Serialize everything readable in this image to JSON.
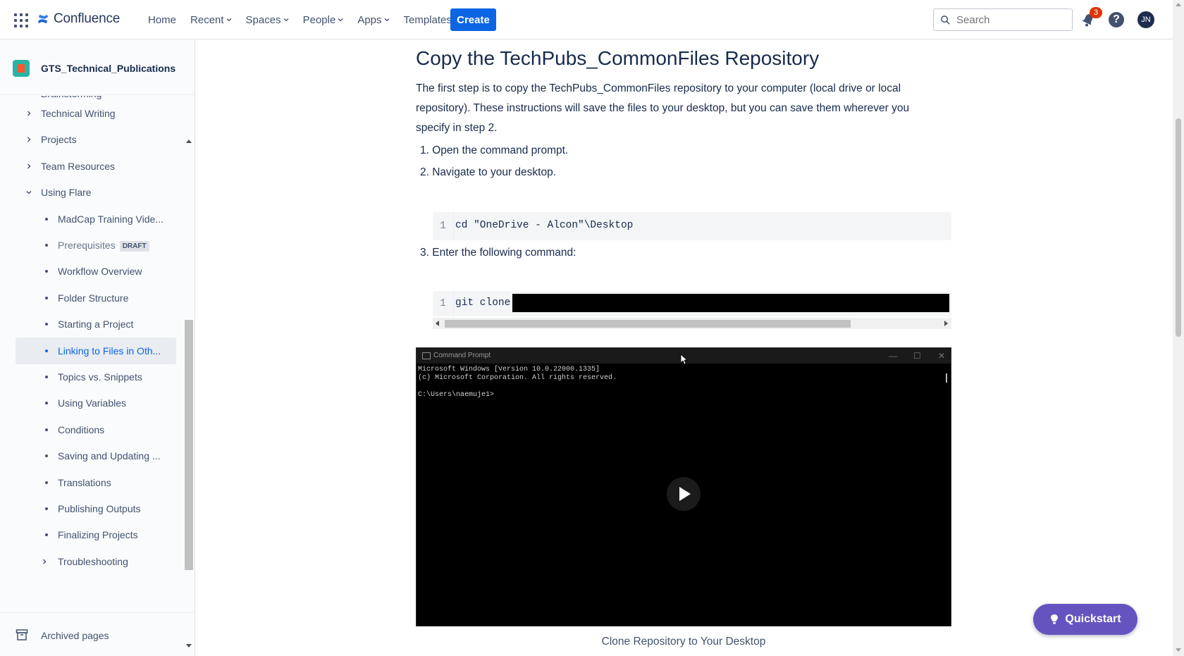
{
  "topbar": {
    "app_name": "Confluence",
    "nav": [
      "Home",
      "Recent",
      "Spaces",
      "People",
      "Apps",
      "Templates"
    ],
    "nav_dropdown": [
      false,
      true,
      true,
      true,
      true,
      false
    ],
    "create_label": "Create",
    "search_placeholder": "Search",
    "notification_count": "3",
    "help_label": "?",
    "avatar_initials": "JN"
  },
  "sidebar": {
    "space_name": "GTS_Technical_Publications",
    "cut_item": "Brainstorming",
    "items": [
      {
        "label": "Technical Writing",
        "level": 1,
        "expanded": false
      },
      {
        "label": "Projects",
        "level": 1,
        "expanded": false
      },
      {
        "label": "Team Resources",
        "level": 1,
        "expanded": false
      },
      {
        "label": "Using Flare",
        "level": 1,
        "expanded": true
      },
      {
        "label": "MadCap Training Vide...",
        "level": 2
      },
      {
        "label": "Prerequisites",
        "level": 2,
        "badge": "DRAFT",
        "muted": true
      },
      {
        "label": "Workflow Overview",
        "level": 2
      },
      {
        "label": "Folder Structure",
        "level": 2
      },
      {
        "label": "Starting a Project",
        "level": 2
      },
      {
        "label": "Linking to Files in Oth...",
        "level": 2,
        "active": true
      },
      {
        "label": "Topics vs. Snippets",
        "level": 2
      },
      {
        "label": "Using Variables",
        "level": 2
      },
      {
        "label": "Conditions",
        "level": 2
      },
      {
        "label": "Saving and Updating ...",
        "level": 2
      },
      {
        "label": "Translations",
        "level": 2
      },
      {
        "label": "Publishing Outputs",
        "level": 2
      },
      {
        "label": "Finalizing Projects",
        "level": 2
      },
      {
        "label": "Troubleshooting",
        "level": 2,
        "caret": true
      }
    ],
    "archived_label": "Archived pages"
  },
  "content": {
    "heading": "Copy the TechPubs_CommonFiles Repository",
    "intro": "The first step is to copy the TechPubs_CommonFiles repository to your computer (local drive or local repository). These instructions will save the files to your desktop, but you can save them wherever you specify in step 2.",
    "steps": [
      "1. Open the command prompt.",
      "2. Navigate to your desktop.",
      "3. Enter the following command:"
    ],
    "code1": {
      "line": "1",
      "text": "cd \"OneDrive - Alcon\"\\Desktop"
    },
    "code2": {
      "line": "1",
      "text": "git clone"
    },
    "video": {
      "window_title": "Command Prompt",
      "lines": [
        "Microsoft Windows [Version 10.0.22000.1335]",
        "(c) Microsoft Corporation. All rights reserved.",
        "",
        "C:\\Users\\naemuje1>"
      ],
      "controls": [
        "—",
        "☐",
        "✕"
      ]
    },
    "caption": "Clone Repository to Your Desktop"
  },
  "quickstart_label": "Quickstart"
}
